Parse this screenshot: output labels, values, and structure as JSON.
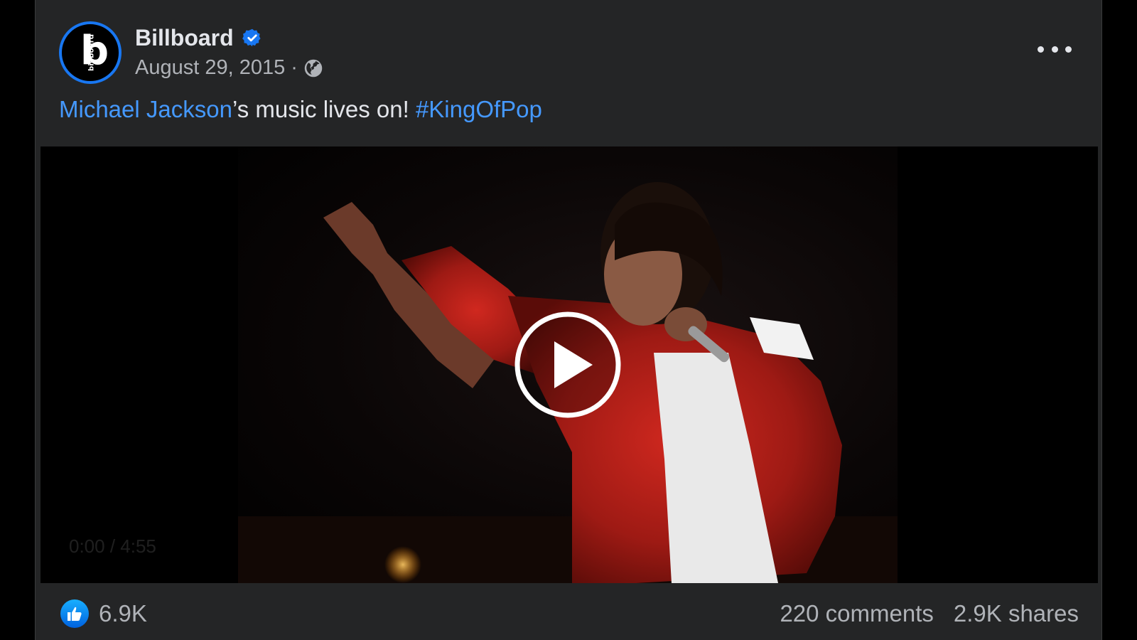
{
  "post": {
    "author": "Billboard",
    "avatar_letter": "b",
    "avatar_text": "billboard",
    "date": "August 29, 2015",
    "separator": "·",
    "text_link_person": "Michael Jackson",
    "text_middle": "’s music lives on! ",
    "text_hashtag": "#KingOfPop",
    "video": {
      "state": "paused",
      "overlay_hint": "0:00 / 4:55"
    },
    "reactions": {
      "count": "6.9K",
      "icon": "like-thumbs-up-icon"
    },
    "comments": "220 comments",
    "shares": "2.9K shares"
  },
  "colors": {
    "card_bg": "#242526",
    "text_primary": "#e4e6eb",
    "text_secondary": "#b0b3b8",
    "link": "#4599ff",
    "accent": "#1877f2"
  }
}
